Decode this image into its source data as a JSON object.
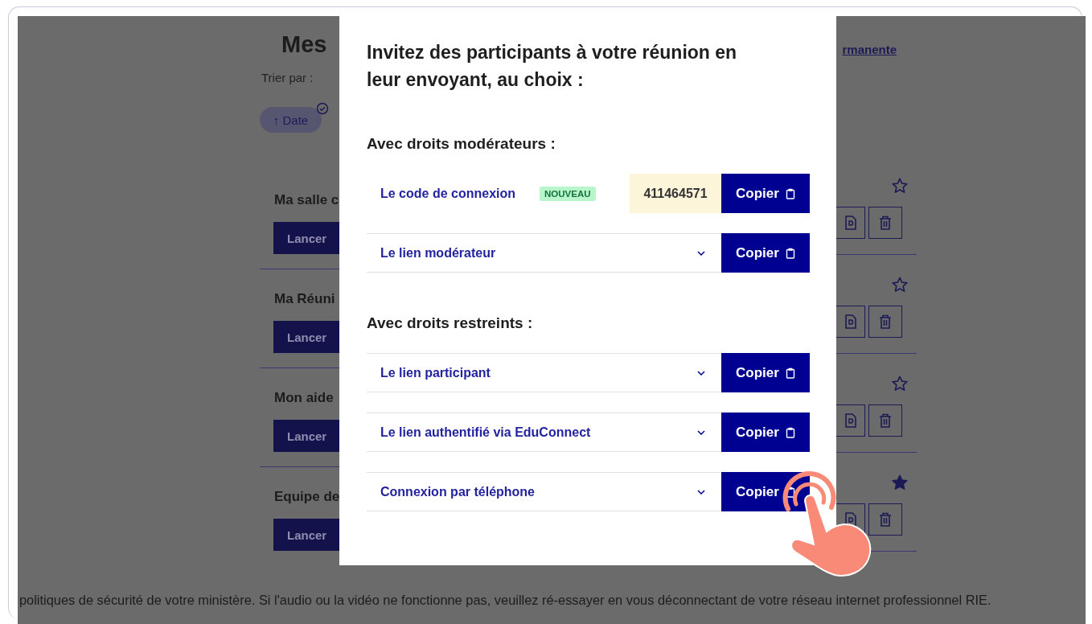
{
  "background_page": {
    "title": "Mes",
    "link": "rmanente",
    "sort_label": "Trier par :",
    "sort_chips": [
      {
        "label": "↑ Date",
        "selected": true
      }
    ],
    "meetings": [
      {
        "title": "Ma salle c",
        "launch": "Lancer",
        "favorite": false
      },
      {
        "title": "Ma Réuni",
        "launch": "Lancer",
        "favorite": false
      },
      {
        "title": "Mon aide",
        "launch": "Lancer",
        "favorite": false
      },
      {
        "title": "Equipe de",
        "launch": "Lancer",
        "favorite": true
      }
    ]
  },
  "dialog": {
    "title": "Invitez des participants à votre réunion en leur envoyant, au choix :",
    "sections": [
      {
        "heading": "Avec droits modérateurs :",
        "rows": [
          {
            "kind": "code",
            "label": "Le code de connexion",
            "badge": "NOUVEAU",
            "value": "411464571",
            "button": "Copier"
          },
          {
            "kind": "dropdown",
            "label": "Le lien modérateur",
            "button": "Copier"
          }
        ]
      },
      {
        "heading": "Avec droits restreints :",
        "rows": [
          {
            "kind": "dropdown",
            "label": "Le lien participant",
            "button": "Copier"
          },
          {
            "kind": "dropdown",
            "label": "Le lien authentifié via EduConnect",
            "button": "Copier"
          },
          {
            "kind": "dropdown",
            "label": "Connexion par téléphone",
            "button": "Copier"
          }
        ]
      }
    ]
  },
  "footer": "politiques de sécurité de votre ministère. Si l'audio ou la vidéo ne fonctionne pas, veuillez ré-essayer en vous déconnectant de votre réseau internet professionnel RIE."
}
